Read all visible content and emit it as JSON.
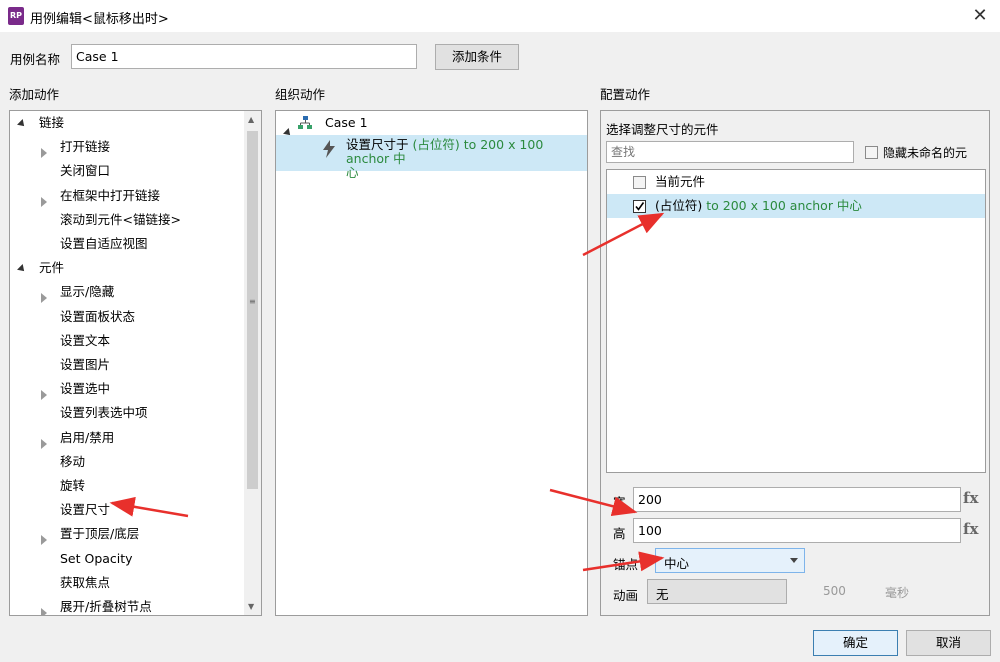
{
  "window": {
    "title": "用例编辑<鼠标移出时>",
    "app_badge": "RP"
  },
  "case_name": {
    "label": "用例名称",
    "value": "Case 1",
    "add_condition": "添加条件"
  },
  "add_actions": {
    "heading": "添加动作",
    "items": [
      {
        "label": "链接",
        "kind": "group"
      },
      {
        "label": "打开链接",
        "kind": "expandable"
      },
      {
        "label": "关闭窗口",
        "kind": "leaf"
      },
      {
        "label": "在框架中打开链接",
        "kind": "expandable"
      },
      {
        "label": "滚动到元件<锚链接>",
        "kind": "leaf"
      },
      {
        "label": "设置自适应视图",
        "kind": "leaf"
      },
      {
        "label": "元件",
        "kind": "group"
      },
      {
        "label": "显示/隐藏",
        "kind": "expandable"
      },
      {
        "label": "设置面板状态",
        "kind": "leaf"
      },
      {
        "label": "设置文本",
        "kind": "leaf"
      },
      {
        "label": "设置图片",
        "kind": "leaf"
      },
      {
        "label": "设置选中",
        "kind": "expandable"
      },
      {
        "label": "设置列表选中项",
        "kind": "leaf"
      },
      {
        "label": "启用/禁用",
        "kind": "expandable"
      },
      {
        "label": "移动",
        "kind": "leaf"
      },
      {
        "label": "旋转",
        "kind": "leaf"
      },
      {
        "label": "设置尺寸",
        "kind": "leaf"
      },
      {
        "label": "置于顶层/底层",
        "kind": "expandable"
      },
      {
        "label": "Set Opacity",
        "kind": "leaf"
      },
      {
        "label": "获取焦点",
        "kind": "leaf"
      },
      {
        "label": "展开/折叠树节点",
        "kind": "expandable"
      }
    ]
  },
  "organize_actions": {
    "heading": "组织动作",
    "case_label": "Case 1",
    "action_prefix": "设置尺寸于 ",
    "action_detail": "(占位符) to 200 x 100 anchor 中",
    "action_wrap": "心"
  },
  "configure_actions": {
    "heading": "配置动作",
    "subheading": "选择调整尺寸的元件",
    "search_placeholder": "查找",
    "hide_unnamed_label": "隐藏未命名的元",
    "widgets": [
      {
        "name": "当前元件",
        "detail": "",
        "checked": false
      },
      {
        "name": "(占位符)",
        "detail": " to 200 x 100 anchor 中心",
        "checked": true
      }
    ],
    "width_label": "宽",
    "width_value": "200",
    "height_label": "高",
    "height_value": "100",
    "fx": "fx",
    "anchor_label": "锚点",
    "anchor_value": "中心",
    "animation_label": "动画",
    "animation_value": "无",
    "time_partial": "500",
    "ms_partial": "毫秒"
  },
  "footer": {
    "ok": "确定",
    "cancel": "取消"
  },
  "colors": {
    "selection": "#cde8f6",
    "arrow": "#e8302c",
    "green_text": "#2b8a3e",
    "ok_border": "#3c7fb1"
  }
}
